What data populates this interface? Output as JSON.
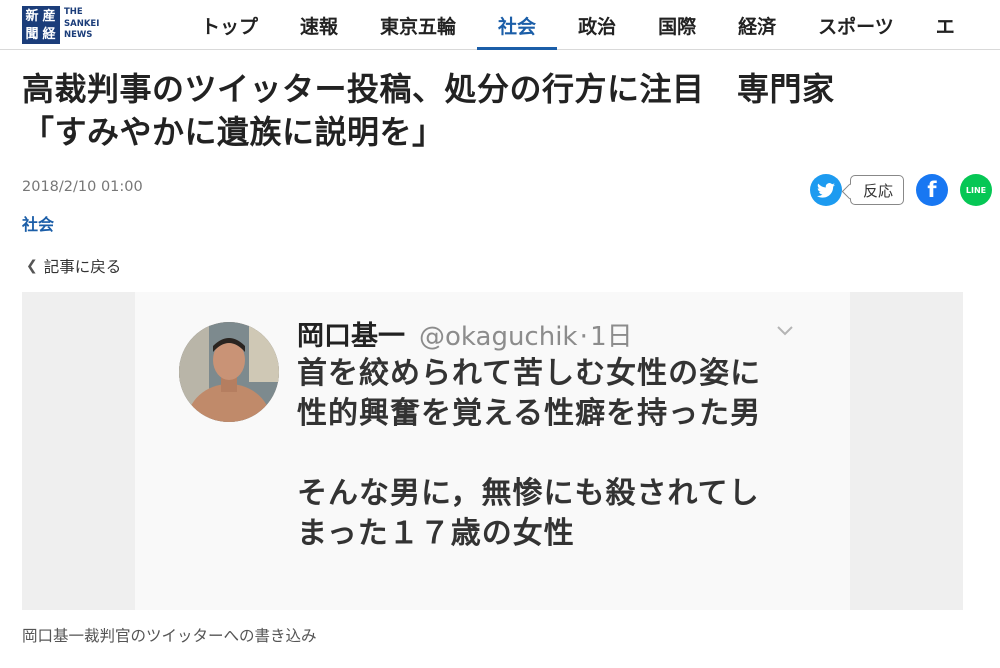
{
  "logo": {
    "kanji": [
      "新",
      "産",
      "聞",
      "経"
    ],
    "english": "THE\nSANKEI\nNEWS",
    "color": "#1b3d7a"
  },
  "nav": {
    "items": [
      "トップ",
      "速報",
      "東京五輪",
      "社会",
      "政治",
      "国際",
      "経済",
      "スポーツ",
      "エ"
    ],
    "active": "社会",
    "active_color": "#1b5ea8"
  },
  "article": {
    "headline_line1": "高裁判事のツイッター投稿、処分の行方に注目　専門家",
    "headline_line2": "「すみやかに遺族に説明を」",
    "date": "2018/2/10 01:00",
    "category": "社会",
    "back_link": "記事に戻る",
    "caption": "岡口基一裁判官のツイッターへの書き込み"
  },
  "share": {
    "twitter_icon": "twitter-icon",
    "reaction_label": "反応",
    "facebook_icon": "facebook-icon",
    "line_label": "LINE",
    "twitter_color": "#1d9bf0",
    "facebook_color": "#1877f2",
    "line_color": "#06c755"
  },
  "tweet": {
    "name": "岡口基一",
    "handle": "@okaguchik",
    "separator": "·",
    "time": "1日",
    "lines": [
      "首を絞められて苦しむ女性の姿に",
      "性的興奮を覚える性癖を持った男",
      "そんな男に，無惨にも殺されてし",
      "まった１７歳の女性"
    ]
  }
}
